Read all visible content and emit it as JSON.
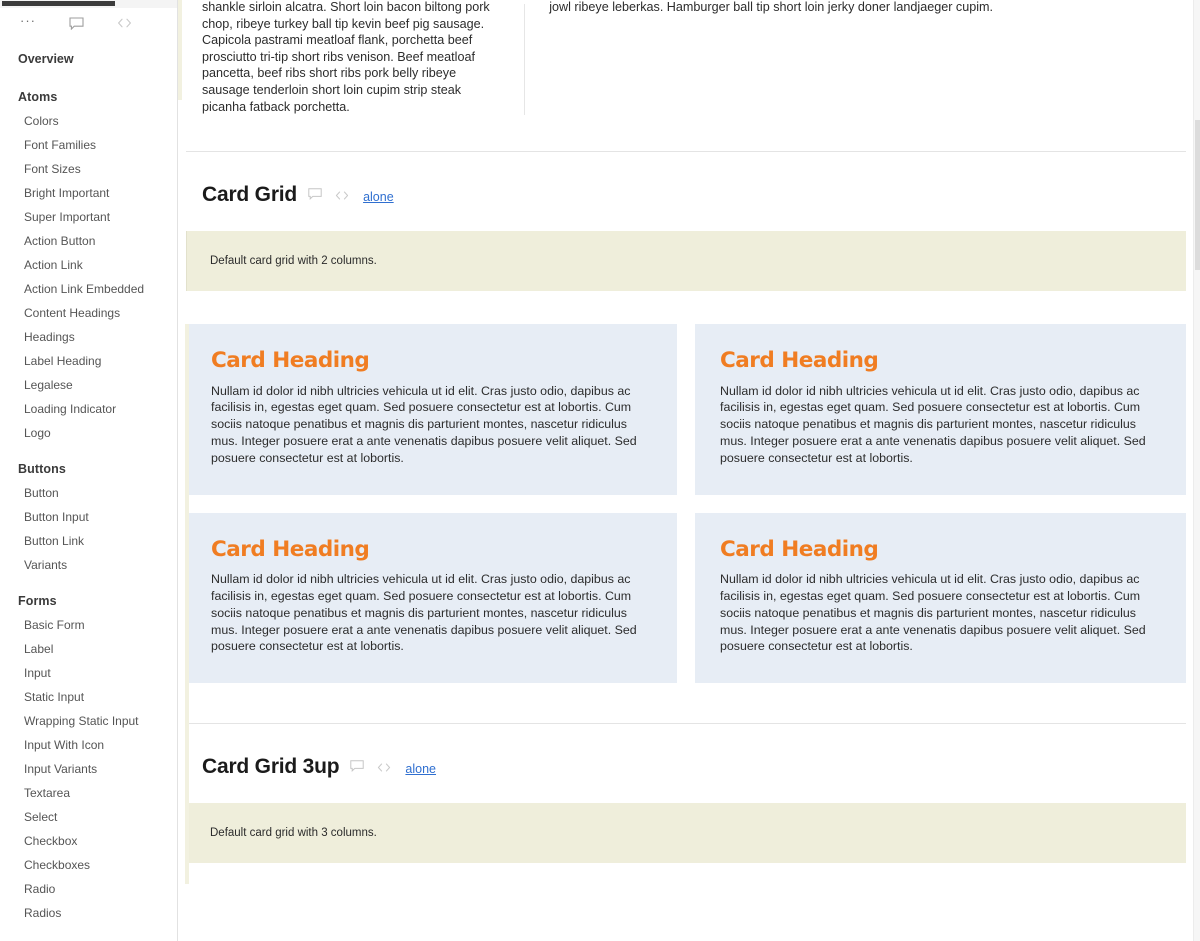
{
  "toolbar": {
    "menu_label": "···",
    "annotations_icon": "speech-bubble-icon",
    "code_icon": "code-icon"
  },
  "sidebar": {
    "overview_label": "Overview",
    "groups": [
      {
        "title": "Atoms",
        "items": [
          {
            "label": "Colors"
          },
          {
            "label": "Font Families"
          },
          {
            "label": "Font Sizes"
          },
          {
            "label": "Bright Important"
          },
          {
            "label": "Super Important"
          },
          {
            "label": "Action Button"
          },
          {
            "label": "Action Link"
          },
          {
            "label": "Action Link Embedded"
          },
          {
            "label": "Content Headings"
          },
          {
            "label": "Headings"
          },
          {
            "label": "Label Heading"
          },
          {
            "label": "Legalese"
          },
          {
            "label": "Loading Indicator"
          },
          {
            "label": "Logo"
          }
        ]
      },
      {
        "title": "Buttons",
        "items": [
          {
            "label": "Button"
          },
          {
            "label": "Button Input"
          },
          {
            "label": "Button Link"
          },
          {
            "label": "Variants"
          }
        ]
      },
      {
        "title": "Forms",
        "items": [
          {
            "label": "Basic Form"
          },
          {
            "label": "Label"
          },
          {
            "label": "Input"
          },
          {
            "label": "Static Input"
          },
          {
            "label": "Wrapping Static Input"
          },
          {
            "label": "Input With Icon"
          },
          {
            "label": "Input Variants"
          },
          {
            "label": "Textarea"
          },
          {
            "label": "Select"
          },
          {
            "label": "Checkbox"
          },
          {
            "label": "Checkboxes"
          },
          {
            "label": "Radio"
          },
          {
            "label": "Radios"
          }
        ]
      }
    ]
  },
  "lead": {
    "left_text": "shankle sirloin alcatra. Short loin bacon biltong pork chop, ribeye turkey ball tip kevin beef pig sausage. Capicola pastrami meatloaf flank, porchetta beef prosciutto tri-tip short ribs venison. Beef meatloaf pancetta, beef ribs short ribs pork belly ribeye sausage tenderloin short loin cupim strip steak picanha fatback porchetta.",
    "right_text": "jowl ribeye leberkas. Hamburger ball tip short loin jerky doner landjaeger cupim."
  },
  "sections": [
    {
      "title": "Card Grid",
      "link_label": "alone",
      "note": "Default card grid with 2 columns.",
      "columns": 2,
      "cards": [
        {
          "heading": "Card Heading",
          "body": "Nullam id dolor id nibh ultricies vehicula ut id elit. Cras justo odio, dapibus ac facilisis in, egestas eget quam. Sed posuere consectetur est at lobortis. Cum sociis natoque penatibus et magnis dis parturient montes, nascetur ridiculus mus. Integer posuere erat a ante venenatis dapibus posuere velit aliquet. Sed posuere consectetur est at lobortis."
        },
        {
          "heading": "Card Heading",
          "body": "Nullam id dolor id nibh ultricies vehicula ut id elit. Cras justo odio, dapibus ac facilisis in, egestas eget quam. Sed posuere consectetur est at lobortis. Cum sociis natoque penatibus et magnis dis parturient montes, nascetur ridiculus mus. Integer posuere erat a ante venenatis dapibus posuere velit aliquet. Sed posuere consectetur est at lobortis."
        },
        {
          "heading": "Card Heading",
          "body": "Nullam id dolor id nibh ultricies vehicula ut id elit. Cras justo odio, dapibus ac facilisis in, egestas eget quam. Sed posuere consectetur est at lobortis. Cum sociis natoque penatibus et magnis dis parturient montes, nascetur ridiculus mus. Integer posuere erat a ante venenatis dapibus posuere velit aliquet. Sed posuere consectetur est at lobortis."
        },
        {
          "heading": "Card Heading",
          "body": "Nullam id dolor id nibh ultricies vehicula ut id elit. Cras justo odio, dapibus ac facilisis in, egestas eget quam. Sed posuere consectetur est at lobortis. Cum sociis natoque penatibus et magnis dis parturient montes, nascetur ridiculus mus. Integer posuere erat a ante venenatis dapibus posuere velit aliquet. Sed posuere consectetur est at lobortis."
        }
      ]
    },
    {
      "title": "Card Grid 3up",
      "link_label": "alone",
      "note": "Default card grid with 3 columns.",
      "columns": 3,
      "cards": []
    }
  ],
  "colors": {
    "card_background": "#e7edf5",
    "card_heading": "#f07d22",
    "note_background": "#efeedb",
    "link": "#2f6fd0",
    "gutter_marker": "#f2f1e0"
  }
}
